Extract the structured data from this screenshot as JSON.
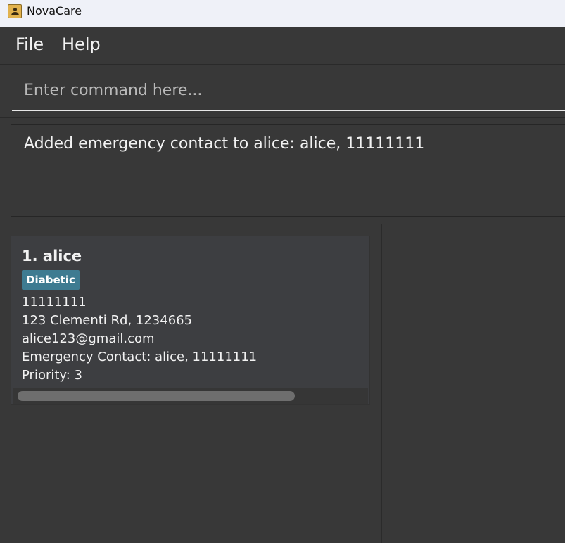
{
  "window": {
    "title": "NovaCare",
    "app_icon": "contact-book-icon"
  },
  "menu": {
    "items": [
      "File",
      "Help"
    ]
  },
  "command": {
    "placeholder": "Enter command here...",
    "value": ""
  },
  "result": {
    "message": "Added emergency contact to alice: alice, 11111111"
  },
  "persons": [
    {
      "index_name": "1. alice",
      "tags": [
        "Diabetic"
      ],
      "phone": "11111111",
      "address": "123 Clementi Rd, 1234665",
      "email": "alice123@gmail.com",
      "emergency_contact": "Emergency Contact: alice, 11111111",
      "priority": "Priority: 3"
    }
  ],
  "colors": {
    "background": "#383838",
    "card": "#3d3e41",
    "tag": "#3e7b91",
    "titlebar": "#eff1f8"
  }
}
